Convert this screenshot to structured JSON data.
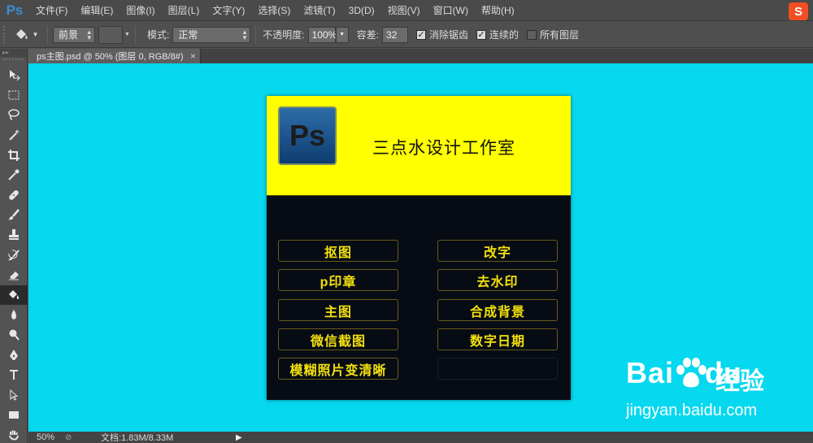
{
  "app": {
    "logo": "Ps"
  },
  "menu": [
    "文件(F)",
    "编辑(E)",
    "图像(I)",
    "图层(L)",
    "文字(Y)",
    "选择(S)",
    "滤镜(T)",
    "3D(D)",
    "视图(V)",
    "窗口(W)",
    "帮助(H)"
  ],
  "sogou_label": "S",
  "options": {
    "fill_source": "前景",
    "mode_label": "模式:",
    "mode_value": "正常",
    "opacity_label": "不透明度:",
    "opacity_value": "100%",
    "tolerance_label": "容差:",
    "tolerance_value": "32",
    "antialias_label": "消除锯齿",
    "antialias_checked": true,
    "contiguous_label": "连续的",
    "contiguous_checked": true,
    "all_layers_label": "所有图层",
    "all_layers_checked": false
  },
  "document_tab": {
    "title": "ps主图.psd @ 50% (图层 0, RGB/8#)",
    "close": "×"
  },
  "canvas": {
    "background": "#05d8ef",
    "header_bg": "#ffff00",
    "body_bg": "#070c14",
    "logo_text": "Ps",
    "studio_name": "三点水设计工作室",
    "services_left": [
      "抠图",
      "p印章",
      "主图",
      "微信截图",
      "模糊照片变清晰"
    ],
    "services_right": [
      "改字",
      "去水印",
      "合成背景",
      "数字日期",
      ""
    ]
  },
  "watermark": {
    "brand": "Bai",
    "brand2": "du",
    "cn": "经验",
    "url": "jingyan.baidu.com"
  },
  "status": {
    "zoom": "50%",
    "doc_info": "文档:1.83M/8.33M",
    "arrow": "▶"
  }
}
